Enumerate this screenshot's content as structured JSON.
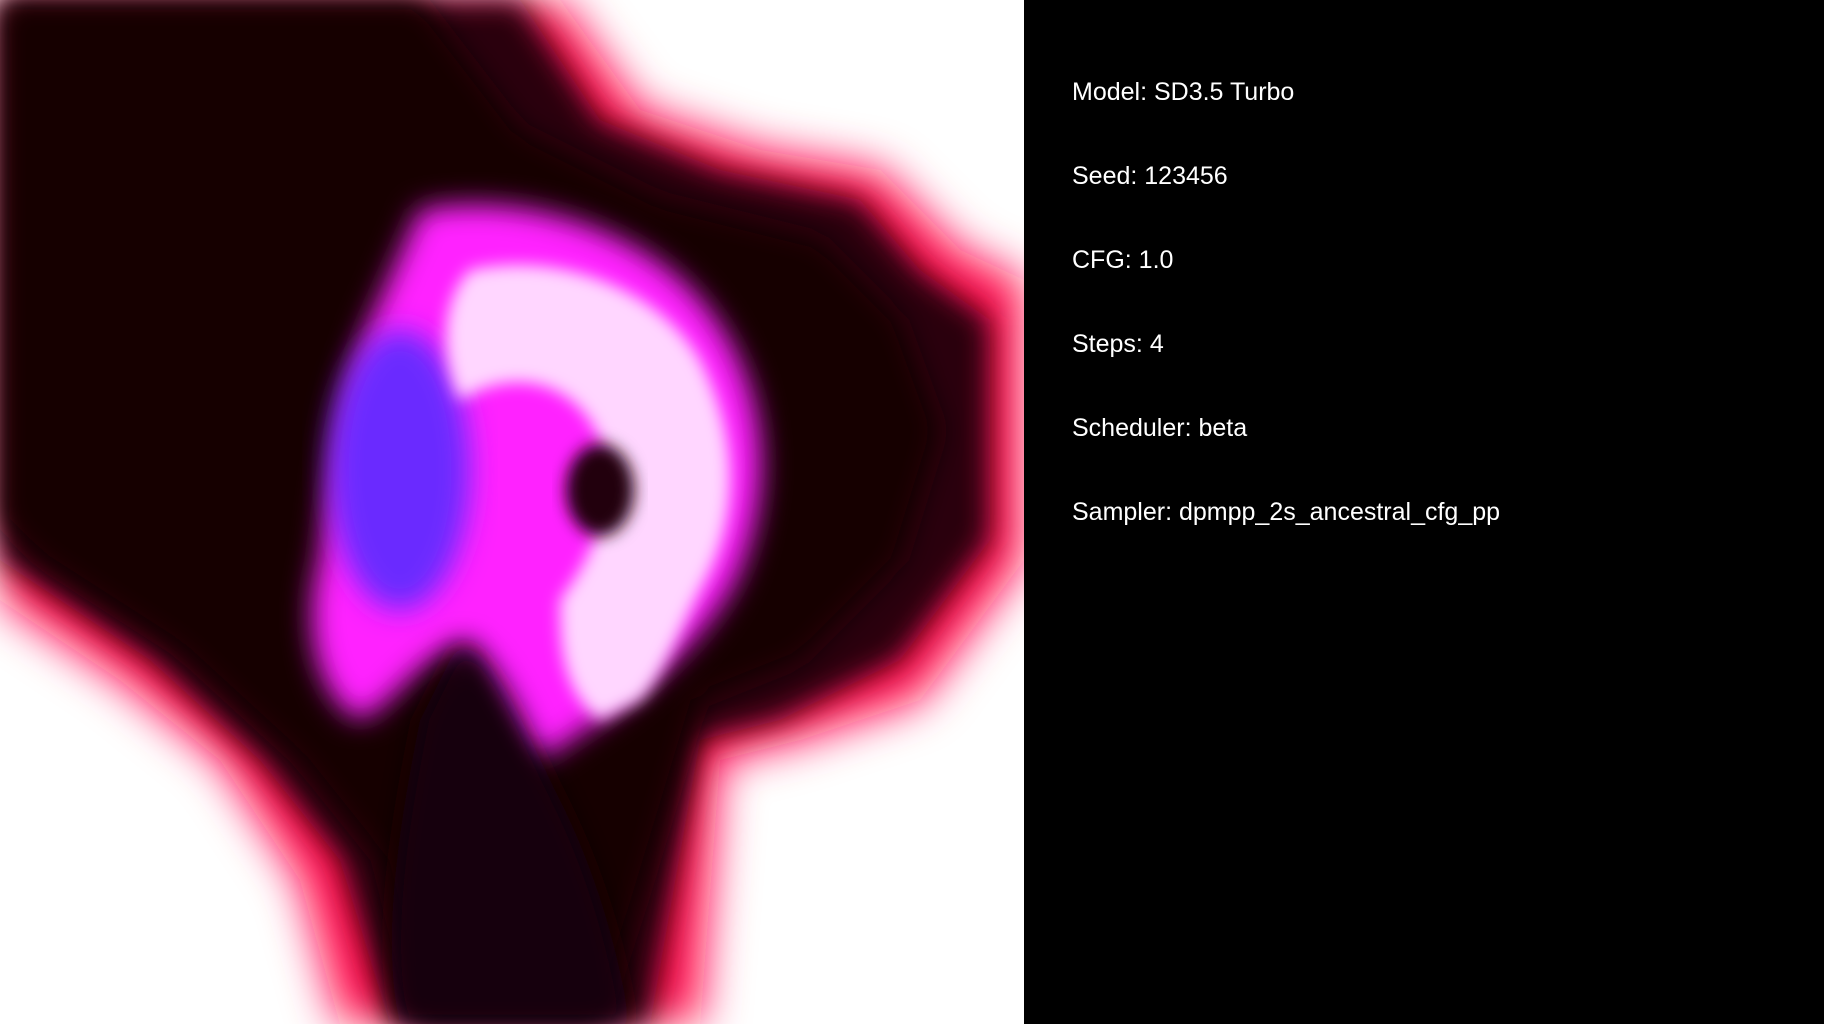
{
  "info": {
    "model": "Model: SD3.5 Turbo",
    "seed": "Seed: 123456",
    "cfg": "CFG: 1.0",
    "steps": "Steps: 4",
    "scheduler": "Scheduler: beta",
    "sampler": "Sampler: dpmpp_2s_ancestral_cfg_pp"
  },
  "image": {
    "description_icon": "generated-image",
    "colors": {
      "white": "#ffffff",
      "red": "#ff1050",
      "dark": "#1a0008",
      "magenta": "#ff20ff",
      "violet": "#7a2cff",
      "light_pink": "#ffd6ff"
    }
  }
}
